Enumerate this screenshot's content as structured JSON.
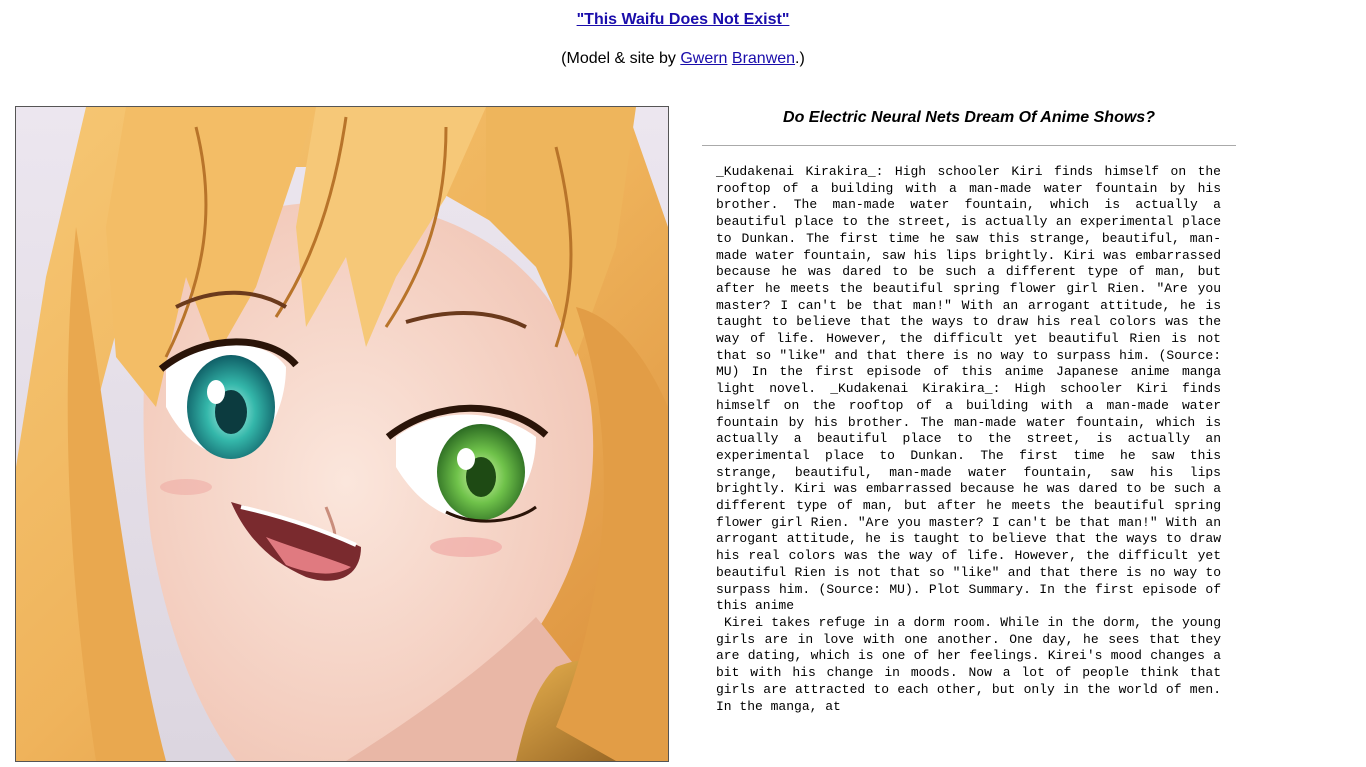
{
  "header": {
    "title": "\"This Waifu Does Not Exist\"",
    "credit_prefix": "(Model & site by ",
    "credit_first": "Gwern",
    "credit_space": " ",
    "credit_last": "Branwen",
    "credit_suffix": ".)"
  },
  "portrait": {
    "alt": "anime girl portrait",
    "colors": {
      "background": "#e8e4ec",
      "hair": "#f1b561",
      "skin": "#f9dcd0",
      "eye_left": "#2fb4a8",
      "eye_right": "#6cc047"
    }
  },
  "story": {
    "heading": "Do Electric Neural Nets Dream Of Anime Shows?",
    "paragraphs": [
      "_Kudakenai Kirakira_: High schooler Kiri finds himself on the rooftop of a building with a man-made water fountain by his brother. The man-made water fountain, which is actually a beautiful place to the street, is actually an experimental place to Dunkan. The first time he saw this strange, beautiful, man-made water fountain, saw his lips brightly. Kiri was embarrassed because he was dared to be such a different type of man, but after he meets the beautiful spring flower girl Rien. \"Are you master? I can't be that man!\" With an arrogant attitude, he is taught to believe that the ways to draw his real colors was the way of life. However, the difficult yet beautiful Rien is not that so \"like\" and that there is no way to surpass him. (Source: MU) In the first episode of this anime Japanese anime manga light novel. _Kudakenai Kirakira_: High schooler Kiri finds himself on the rooftop of a building with a man-made water fountain by his brother. The man-made water fountain, which is actually a beautiful place to the street, is actually an experimental place to Dunkan. The first time he saw this strange, beautiful, man-made water fountain, saw his lips brightly. Kiri was embarrassed because he was dared to be such a different type of man, but after he meets the beautiful spring flower girl Rien. \"Are you master? I can't be that man!\" With an arrogant attitude, he is taught to believe that the ways to draw his real colors was the way of life. However, the difficult yet beautiful Rien is not that so \"like\" and that there is no way to surpass him. (Source: MU). Plot Summary. In the first episode of this anime",
      "Kirei takes refuge in a dorm room. While in the dorm, the young girls are in love with one another. One day, he sees that they are dating, which is one of her feelings. Kirei's mood changes a bit with his change in moods. Now a lot of people think that girls are attracted to each other, but only in the world of men. In the manga, at"
    ]
  }
}
